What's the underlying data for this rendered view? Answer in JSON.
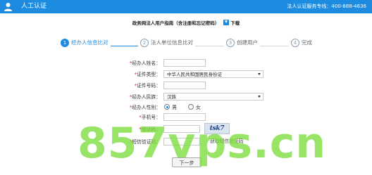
{
  "header": {
    "title": "人工认证",
    "hotline": "法人认证服务专线：400-888-4636",
    "user_icon": "user-icon",
    "bg_color": "#1d8ce0"
  },
  "guide": {
    "text": "政务网法人用户指南（含注册和忘记密码）",
    "download_label": "下载",
    "download_icon": "download-icon"
  },
  "steps": [
    {
      "num": "1",
      "label": "经办人信息比对",
      "active": true
    },
    {
      "num": "2",
      "label": "法人单位信息比对",
      "active": false
    },
    {
      "num": "3",
      "label": "创建用户",
      "active": false
    },
    {
      "num": "4",
      "label": "完成",
      "active": false
    }
  ],
  "form": {
    "name_label": "经办人姓名：",
    "name_value": "",
    "cert_type_label": "证件类型：",
    "cert_type_value": "中华人民共和国居民身份证",
    "cert_no_label": "证件号码：",
    "cert_no_value": "",
    "ethnicity_label": "经办人民族：",
    "ethnicity_value": "汉族",
    "gender_label": "经办人性别：",
    "gender_male": "男",
    "gender_female": "女",
    "gender_selected": "男",
    "phone_label": "手机号：",
    "phone_value": "",
    "captcha_label": "验证码：",
    "captcha_value": "",
    "captcha_image_text": "tsk7",
    "sms_label": "短信验证码：",
    "sms_value": "",
    "sms_button": "获取短信验证码",
    "required_mark": "*"
  },
  "next_button": "下一步",
  "watermark": "857vps.cn"
}
